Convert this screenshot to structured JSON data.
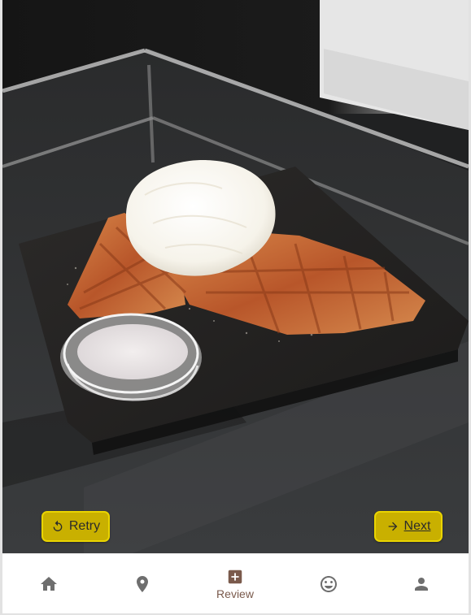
{
  "actions": {
    "retry_label": "Retry",
    "next_label": "Next"
  },
  "nav": {
    "items": [
      {
        "id": "home",
        "icon": "home-icon",
        "label": "",
        "active": false
      },
      {
        "id": "location",
        "icon": "location-pin-icon",
        "label": "",
        "active": false
      },
      {
        "id": "review",
        "icon": "add-box-icon",
        "label": "Review",
        "active": true
      },
      {
        "id": "mood",
        "icon": "smiley-icon",
        "label": "",
        "active": false
      },
      {
        "id": "profile",
        "icon": "person-icon",
        "label": "",
        "active": false
      }
    ]
  },
  "colors": {
    "action_button": "#c9b000",
    "nav_icon": "#6e6e6e",
    "nav_active": "#7a5a4c"
  }
}
